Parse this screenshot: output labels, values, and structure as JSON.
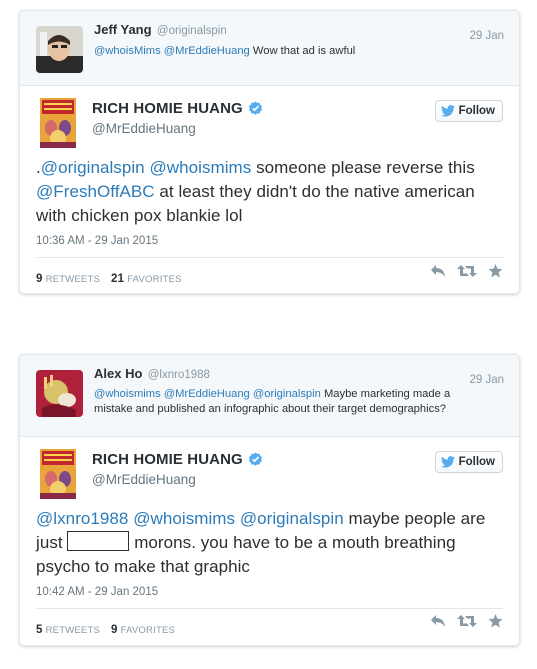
{
  "tweets": [
    {
      "parent": {
        "name": "Jeff Yang",
        "handle": "@originalspin",
        "date": "29 Jan",
        "text_parts": [
          "@whoisMims",
          " ",
          "@MrEddieHuang",
          " Wow that ad is awful"
        ]
      },
      "main": {
        "name": "RICH HOMIE HUANG",
        "handle": "@MrEddieHuang",
        "follow_label": "Follow",
        "text_parts": [
          ".",
          "@originalspin",
          " ",
          "@whoismims",
          " someone please reverse this ",
          "@FreshOffABC",
          " at least they didn't do the native american with chicken pox blankie lol"
        ],
        "timestamp": "10:36 AM - 29 Jan 2015",
        "retweets": "9",
        "retweets_label": "RETWEETS",
        "favorites": "21",
        "favorites_label": "FAVORITES"
      }
    },
    {
      "parent": {
        "name": "Alex Ho",
        "handle": "@lxnro1988",
        "date": "29 Jan",
        "text_parts": [
          "@whoismims",
          " ",
          "@MrEddieHuang",
          " ",
          "@originalspin",
          " Maybe marketing made a mistake and published an infographic about their target demographics?"
        ]
      },
      "main": {
        "name": "RICH HOMIE HUANG",
        "handle": "@MrEddieHuang",
        "follow_label": "Follow",
        "text_parts": [
          "@lxnro1988",
          " ",
          "@whoismims",
          " ",
          "@originalspin",
          " maybe people are just ",
          "[redacted]",
          " morons. you have to be a mouth breathing psycho to make that graphic"
        ],
        "timestamp": "10:42 AM - 29 Jan 2015",
        "retweets": "5",
        "retweets_label": "RETWEETS",
        "favorites": "9",
        "favorites_label": "FAVORITES"
      }
    }
  ],
  "colors": {
    "link": "#2b7bb9",
    "text": "#292f33",
    "muted": "#8899a6",
    "verified": "#55acee",
    "follow_bird": "#55acee"
  },
  "icons": [
    "reply-icon",
    "retweet-icon",
    "favorite-icon",
    "verified-icon",
    "twitter-bird-icon"
  ]
}
